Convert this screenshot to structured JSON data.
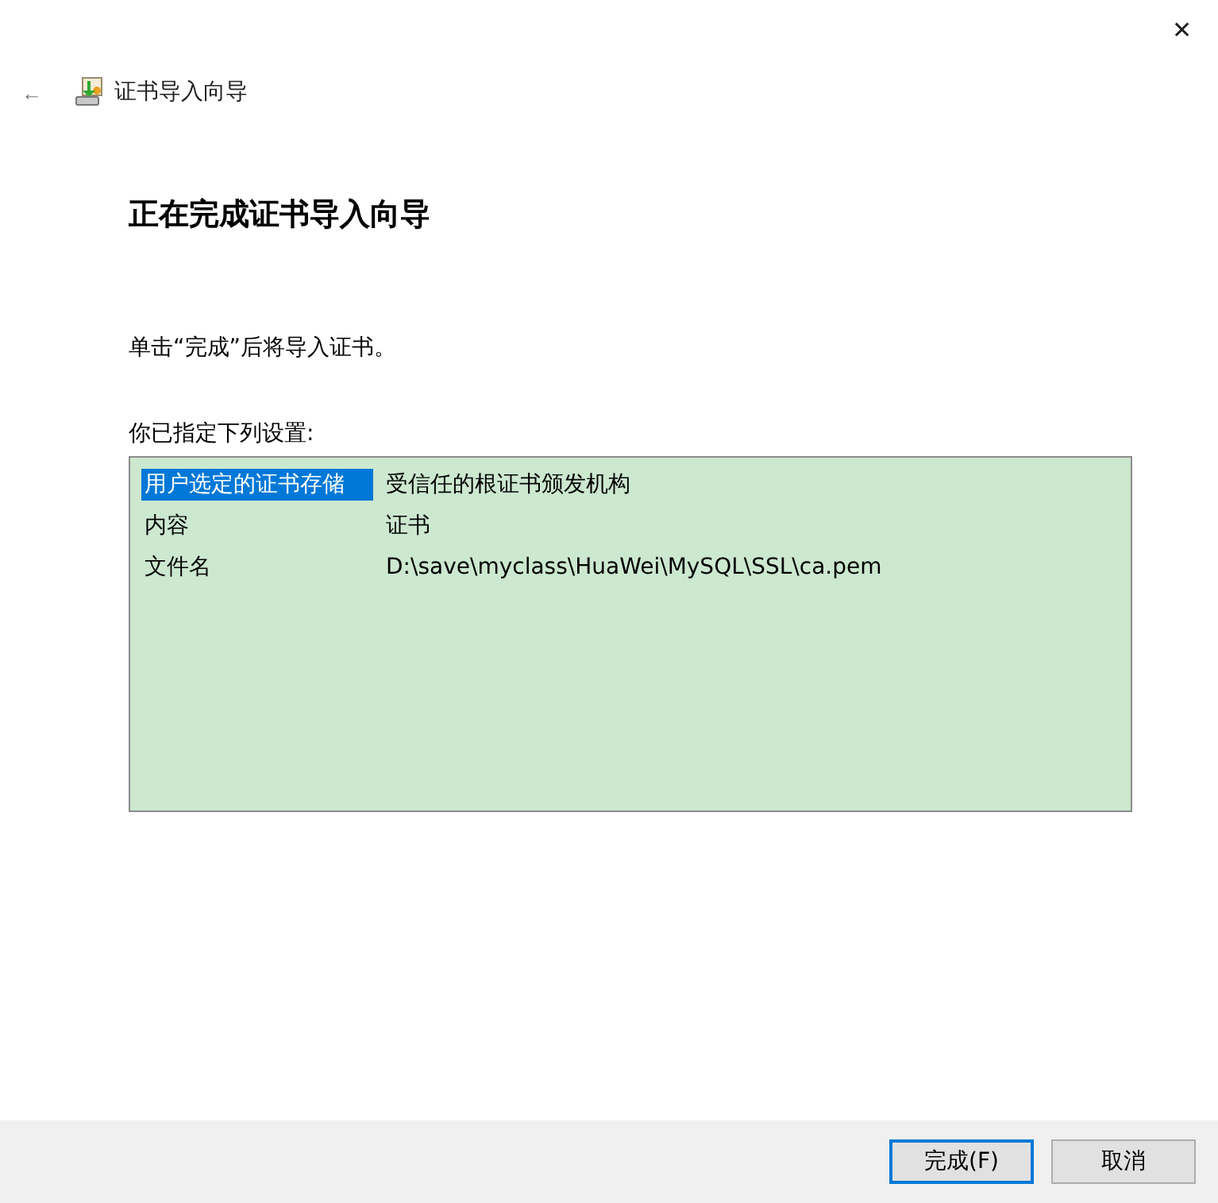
{
  "window": {
    "close": "✕",
    "back": "←",
    "title": "证书导入向导"
  },
  "heading": "正在完成证书导入向导",
  "instruction": "单击“完成”后将导入证书。",
  "settings_label": "你已指定下列设置:",
  "settings": [
    {
      "name": "用户选定的证书存储",
      "value": "受信任的根证书颁发机构",
      "selected": true
    },
    {
      "name": "内容",
      "value": "证书",
      "selected": false
    },
    {
      "name": "文件名",
      "value": "D:\\save\\myclass\\HuaWei\\MySQL\\SSL\\ca.pem",
      "selected": false
    }
  ],
  "buttons": [
    {
      "label": "完成(F)",
      "default": true
    },
    {
      "label": "取消",
      "default": false
    }
  ]
}
